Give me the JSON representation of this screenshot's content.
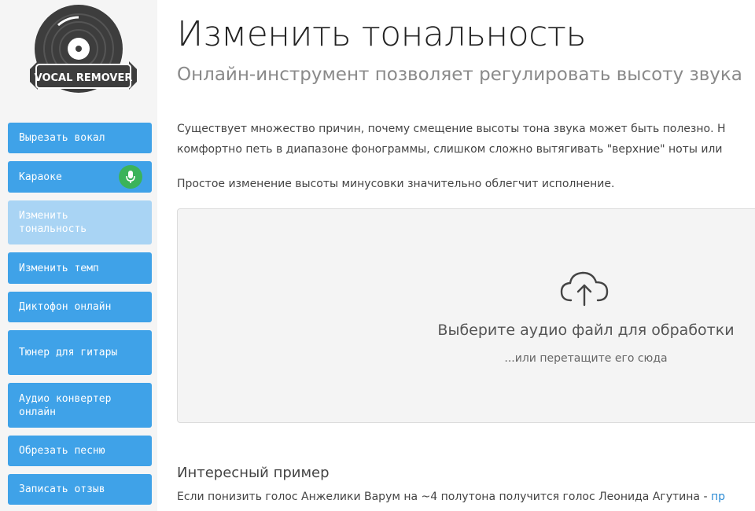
{
  "logo": {
    "text": "VOCAL REMOVER"
  },
  "sidebar": {
    "items": [
      {
        "label": "Вырезать вокал",
        "active": false
      },
      {
        "label": "Караоке",
        "active": false,
        "badge_icon": "microphone-icon"
      },
      {
        "label": "Изменить тональность",
        "active": true
      },
      {
        "label": "Изменить темп",
        "active": false
      },
      {
        "label": "Диктофон онлайн",
        "active": false
      },
      {
        "label": "Тюнер для гитары",
        "active": false
      },
      {
        "label": "Аудио конвертер онлайн",
        "active": false
      },
      {
        "label": "Обрезать песню",
        "active": false
      },
      {
        "label": "Записать отзыв",
        "active": false
      }
    ]
  },
  "page": {
    "title": "Изменить тональность",
    "subtitle": "Онлайн-инструмент позволяет регулировать высоту звука",
    "intro_line1": "Существует множество причин, почему смещение высоты тона звука может быть полезно. Н",
    "intro_line2": "комфортно петь в диапазоне фонограммы, слишком сложно вытягивать \"верхние\" ноты или",
    "intro_line3": "Простое изменение высоты минусовки значительно облегчит исполнение."
  },
  "dropzone": {
    "icon": "cloud-upload-icon",
    "title": "Выберите аудио файл для обработки",
    "hint": "...или перетащите его сюда"
  },
  "example": {
    "heading": "Интересный пример",
    "text": "Если понизить голос Анжелики Варум на ~4 полутона получится голос Леонида Агутина - ",
    "link": "пр"
  },
  "colors": {
    "nav_bg": "#3fa2e8",
    "nav_active_bg": "#a9d4f4",
    "badge_green": "#3bb35a",
    "link": "#2a8ad4"
  }
}
